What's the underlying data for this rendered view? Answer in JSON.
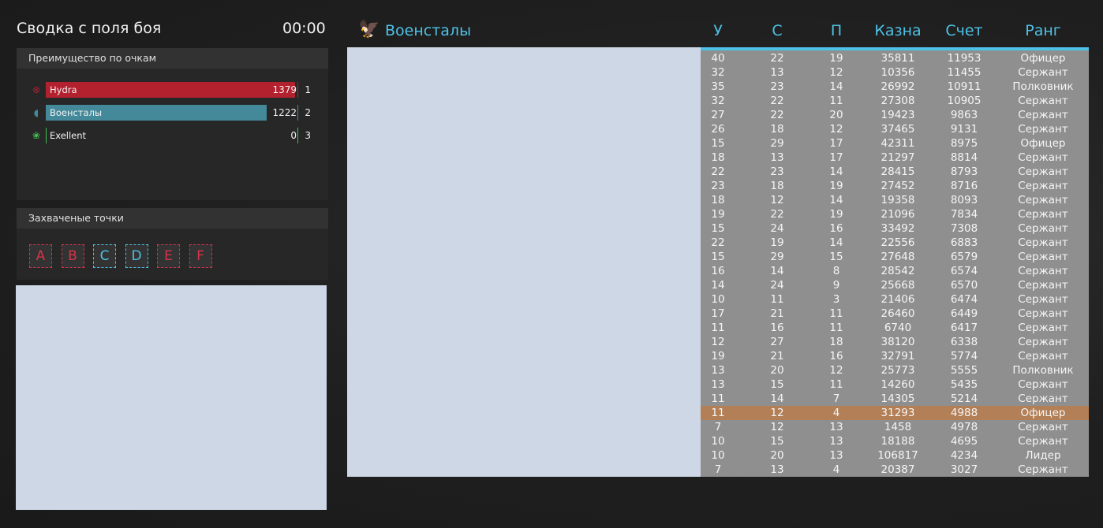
{
  "summary": {
    "title": "Сводка с поля боя",
    "timer": "00:00"
  },
  "advantage": {
    "title": "Преимущество по очкам",
    "teams": [
      {
        "name": "Hydra",
        "score": "1379",
        "rank": "1",
        "color": "#b3202e",
        "fill": 1.0,
        "icon": "hydra-icon"
      },
      {
        "name": "Военсталы",
        "score": "1222",
        "rank": "2",
        "color": "#43899a",
        "fill": 0.886,
        "icon": "eagle-icon"
      },
      {
        "name": "Exellent",
        "score": "0",
        "rank": "3",
        "color": "#40c050",
        "fill": 0.0,
        "icon": "flower-icon"
      }
    ]
  },
  "capture": {
    "title": "Захваченые точки",
    "points": [
      {
        "label": "A",
        "color": "#d83348"
      },
      {
        "label": "B",
        "color": "#d83348"
      },
      {
        "label": "C",
        "color": "#4ec2e6"
      },
      {
        "label": "D",
        "color": "#4ec2e6"
      },
      {
        "label": "E",
        "color": "#d83348"
      },
      {
        "label": "F",
        "color": "#d83348"
      }
    ]
  },
  "faction": {
    "name": "Военсталы",
    "icon": "eagle-icon",
    "color": "#4ec2e6"
  },
  "table": {
    "headers": [
      "У",
      "С",
      "П",
      "Казна",
      "Счет",
      "Ранг"
    ],
    "highlight_row": 25,
    "rows": [
      [
        "40",
        "22",
        "19",
        "35811",
        "11953",
        "Офицер"
      ],
      [
        "32",
        "13",
        "12",
        "10356",
        "11455",
        "Сержант"
      ],
      [
        "35",
        "23",
        "14",
        "26992",
        "10911",
        "Полковник"
      ],
      [
        "32",
        "22",
        "11",
        "27308",
        "10905",
        "Сержант"
      ],
      [
        "27",
        "22",
        "20",
        "19423",
        "9863",
        "Сержант"
      ],
      [
        "26",
        "18",
        "12",
        "37465",
        "9131",
        "Сержант"
      ],
      [
        "15",
        "29",
        "17",
        "42311",
        "8975",
        "Офицер"
      ],
      [
        "18",
        "13",
        "17",
        "21297",
        "8814",
        "Сержант"
      ],
      [
        "22",
        "23",
        "14",
        "28415",
        "8793",
        "Сержант"
      ],
      [
        "23",
        "18",
        "19",
        "27452",
        "8716",
        "Сержант"
      ],
      [
        "18",
        "12",
        "14",
        "19358",
        "8093",
        "Сержант"
      ],
      [
        "19",
        "22",
        "19",
        "21096",
        "7834",
        "Сержант"
      ],
      [
        "15",
        "24",
        "16",
        "33492",
        "7308",
        "Сержант"
      ],
      [
        "22",
        "19",
        "14",
        "22556",
        "6883",
        "Сержант"
      ],
      [
        "15",
        "29",
        "15",
        "27648",
        "6579",
        "Сержант"
      ],
      [
        "16",
        "14",
        "8",
        "28542",
        "6574",
        "Сержант"
      ],
      [
        "14",
        "24",
        "9",
        "25668",
        "6570",
        "Сержант"
      ],
      [
        "10",
        "11",
        "3",
        "21406",
        "6474",
        "Сержант"
      ],
      [
        "17",
        "21",
        "11",
        "26460",
        "6449",
        "Сержант"
      ],
      [
        "11",
        "16",
        "11",
        "6740",
        "6417",
        "Сержант"
      ],
      [
        "12",
        "27",
        "18",
        "38120",
        "6338",
        "Сержант"
      ],
      [
        "19",
        "21",
        "16",
        "32791",
        "5774",
        "Сержант"
      ],
      [
        "13",
        "20",
        "12",
        "25773",
        "5555",
        "Полковник"
      ],
      [
        "13",
        "15",
        "11",
        "14260",
        "5435",
        "Сержант"
      ],
      [
        "11",
        "14",
        "7",
        "14305",
        "5214",
        "Сержант"
      ],
      [
        "11",
        "12",
        "4",
        "31293",
        "4988",
        "Офицер"
      ],
      [
        "7",
        "12",
        "13",
        "1458",
        "4978",
        "Сержант"
      ],
      [
        "10",
        "15",
        "13",
        "18188",
        "4695",
        "Сержант"
      ],
      [
        "10",
        "20",
        "13",
        "106817",
        "4234",
        "Лидер"
      ],
      [
        "7",
        "13",
        "4",
        "20387",
        "3027",
        "Сержант"
      ]
    ]
  }
}
